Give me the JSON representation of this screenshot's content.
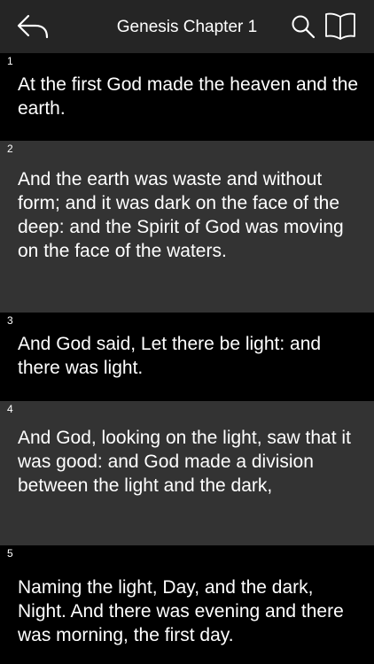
{
  "navbar": {
    "title": "Genesis Chapter 1",
    "icons": {
      "back": "back-arrow-icon",
      "search": "search-icon",
      "book": "book-icon"
    }
  },
  "colors": {
    "navbar_bg": "#252525",
    "verse_dark_bg": "#000000",
    "verse_light_bg": "#333333",
    "text": "#ffffff"
  },
  "verses": [
    {
      "number": "1",
      "text": "At the first God made the heaven and the earth."
    },
    {
      "number": "2",
      "text": "And the earth was waste and without form; and it was dark on the face of the deep: and the Spirit of God was moving on the face of the waters."
    },
    {
      "number": "3",
      "text": "And God said, Let there be light: and there was light."
    },
    {
      "number": "4",
      "text": "And God, looking on the light, saw that it was good: and God made a division between the light and the dark,"
    },
    {
      "number": "5",
      "text": "Naming the light, Day, and the dark, Night. And there was evening and there was morning, the first day."
    }
  ]
}
